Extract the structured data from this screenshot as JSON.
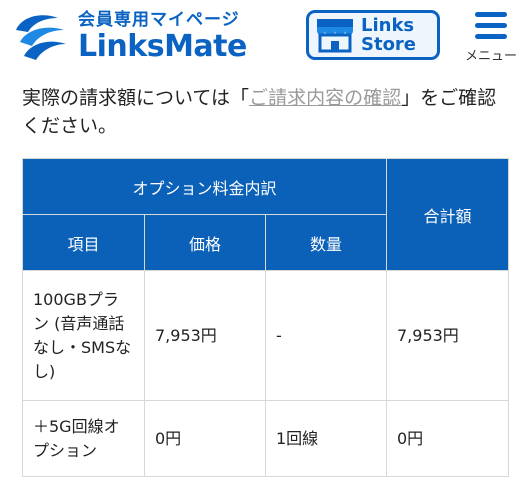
{
  "header": {
    "logo_sub": "会員専用マイページ",
    "logo_main": "LinksMate",
    "store_line1": "Links",
    "store_line2": "Store",
    "menu_label": "メニュー"
  },
  "colors": {
    "brand": "#0a63c2",
    "table_header": "#0b61b8",
    "link_gray": "#9a9a9a",
    "border": "#d8d8d8"
  },
  "notice": {
    "prefix": "実際の請求額については「",
    "link": "ご請求内容の確認",
    "suffix": "」をご確認ください。"
  },
  "table": {
    "group_header": "オプション料金内訳",
    "total_header": "合計額",
    "columns": [
      "項目",
      "価格",
      "数量"
    ],
    "rows": [
      {
        "item": "100GBプラン (音声通話なし・SMSなし)",
        "price": "7,953円",
        "qty": "-",
        "total": "7,953円"
      },
      {
        "item": "＋5G回線オプション",
        "price": "0円",
        "qty": "1回線",
        "total": "0円"
      }
    ]
  }
}
